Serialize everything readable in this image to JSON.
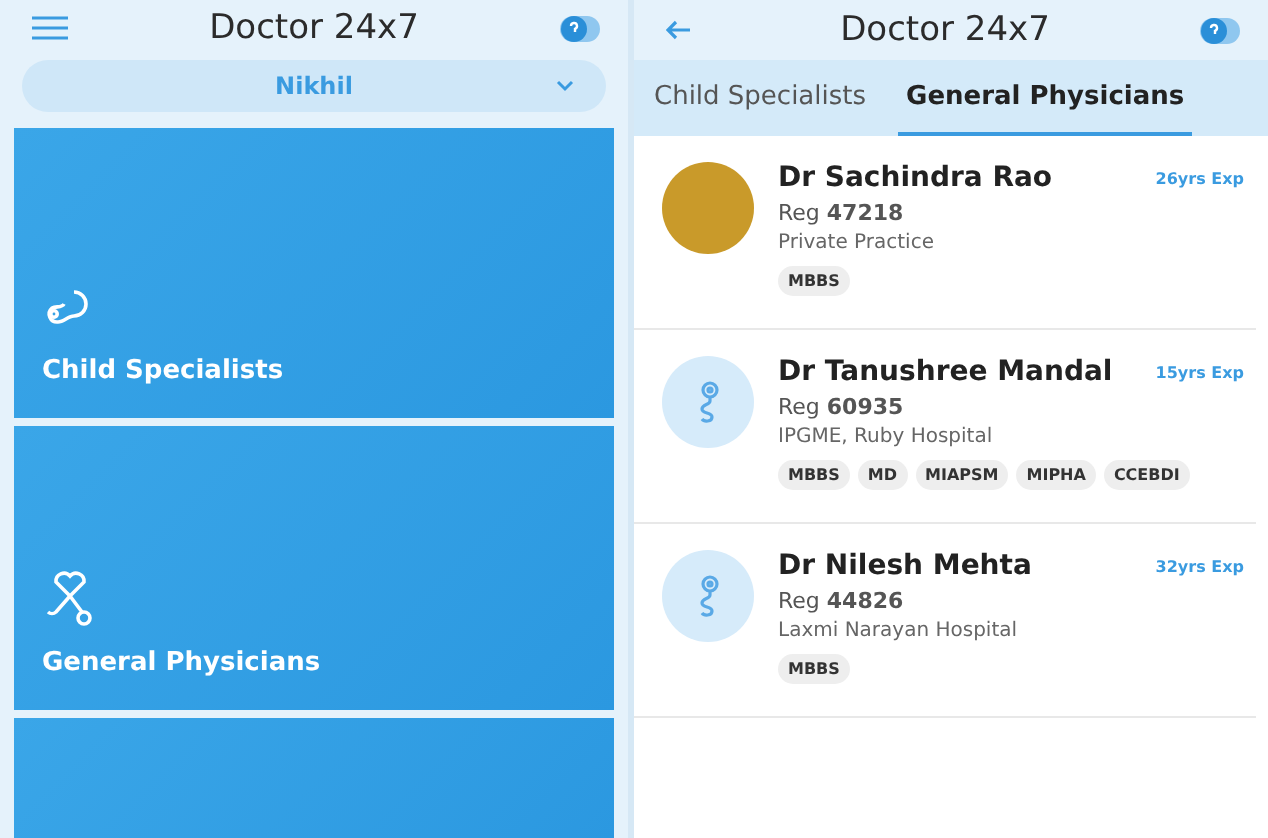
{
  "left_screen": {
    "title": "Doctor 24x7",
    "profile_select": {
      "value": "Nikhil"
    },
    "categories": [
      {
        "label": "Child Specialists",
        "kind": "baby"
      },
      {
        "label": "General Physicians",
        "kind": "stethoscope"
      },
      {
        "kind": "blank"
      }
    ]
  },
  "right_screen": {
    "title": "Doctor 24x7",
    "tabs": [
      {
        "label": "Child Specialists",
        "selected": false
      },
      {
        "label": "General Physicians",
        "selected": true
      }
    ],
    "doctors": [
      {
        "name": "Dr Sachindra Rao",
        "reg": "Reg **47218**",
        "practice": "Private Practice",
        "experience": "26yrs Exp",
        "kind": "photo",
        "degrees": [
          "MBBS"
        ]
      },
      {
        "name": "Dr Tanushree Mandal",
        "reg": "Reg **60935**",
        "practice": "IPGME, Ruby Hospital",
        "experience": "15yrs Exp",
        "kind": "icon",
        "degrees": [
          "MBBS",
          "MD",
          "MIAPSM",
          "MIPHA",
          "CCEBDI"
        ]
      },
      {
        "name": "Dr Nilesh Mehta",
        "reg": "Reg **44826**",
        "practice": "Laxmi Narayan Hospital",
        "experience": "32yrs Exp",
        "kind": "icon",
        "degrees": [
          "MBBS"
        ]
      }
    ]
  }
}
